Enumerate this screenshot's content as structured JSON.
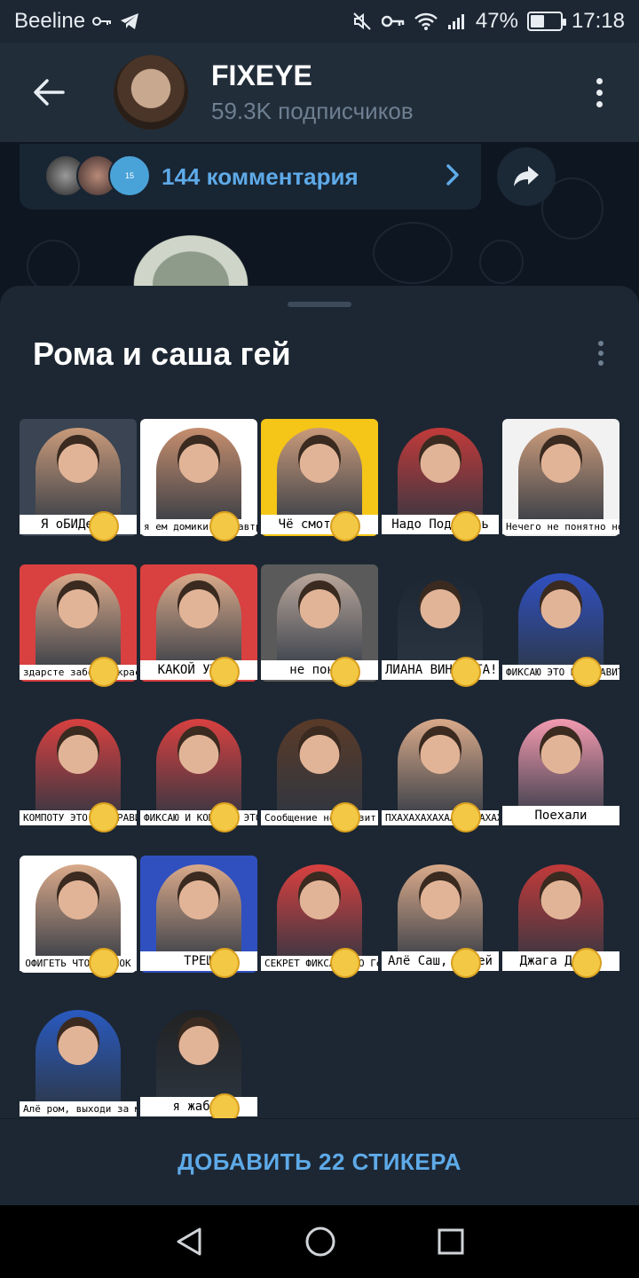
{
  "status_bar": {
    "carrier": "Beeline",
    "battery": "47%",
    "battery_level": 0.47,
    "time": "17:18"
  },
  "header": {
    "channel_name": "FIXEYE",
    "subscribers": "59.3K подписчиков"
  },
  "post": {
    "comments_label": "144 комментария",
    "comment_avatar_badge": "15"
  },
  "sheet": {
    "title": "Рома и саша гей",
    "add_button_label": "ДОБАВИТЬ 22 СТИКЕРА",
    "stickers": [
      {
        "caption": "Я оБИДеЛСЯ",
        "bg": "#3a4452",
        "tone": "#c99a7a",
        "emoji": true
      },
      {
        "caption": "я ем домики на завтрак",
        "bg": "#ffffff",
        "tone": "#c68e6e",
        "emoji": true
      },
      {
        "caption": "Чё смотришь",
        "bg": "#f5c518",
        "tone": "#c99a7a",
        "emoji": true
      },
      {
        "caption": "Надо Подумать",
        "bg": "#1d2733",
        "tone": "#c23a3a",
        "emoji": true
      },
      {
        "caption": "Нечего не понятно но очень интересно",
        "bg": "#f2f2f2",
        "tone": "#c99a7a",
        "emoji": false
      },
      {
        "caption": "здарсте забор покрасте",
        "bg": "#d94040",
        "tone": "#d9a98a",
        "emoji": true
      },
      {
        "caption": "КАКОЙ УЖАС!",
        "bg": "#d94040",
        "tone": "#d9a98a",
        "emoji": true
      },
      {
        "caption": "не понял",
        "bg": "#5a5a5a",
        "tone": "#b8a59a",
        "emoji": true
      },
      {
        "caption": "ЛИАНА ВИНОВАТА!",
        "bg": "#1d2733",
        "tone": "#1d2733",
        "emoji": true
      },
      {
        "caption": "ФИКСАЮ ЭТО НЕ НРАВИТСЯ",
        "bg": "#1d2733",
        "tone": "#3050c0",
        "emoji": true
      },
      {
        "caption": "КОМПОТУ ЭТО НЕ НРАВИТСЯ",
        "bg": "#1d2733",
        "tone": "#d94040",
        "emoji": true
      },
      {
        "caption": "ФИКСАЮ И КОМПОТУ ЭТО НЕ НРАВИТСЯ",
        "bg": "#1d2733",
        "tone": "#d94040",
        "emoji": true
      },
      {
        "caption": "Сообщение не грузит",
        "bg": "#1d2733",
        "tone": "#5a3a28",
        "emoji": true
      },
      {
        "caption": "ПХАХАХАХАХААХХАХАХАХА ХАХАХАХАААХАХАХАХАХ",
        "bg": "#1d2733",
        "tone": "#d9a98a",
        "emoji": true
      },
      {
        "caption": "Поехали",
        "bg": "#1d2733",
        "tone": "#f39ab0",
        "emoji": false
      },
      {
        "caption": "ОФИГЕТЬ ЧТОООО ШОК",
        "bg": "#ffffff",
        "tone": "#d9a98a",
        "emoji": true
      },
      {
        "caption": "ТРЕШ",
        "bg": "#3050c0",
        "tone": "#d9a98a",
        "emoji": true
      },
      {
        "caption": "СЕКРЕТ ФИКСАЯ ЭТО Гей",
        "bg": "#1d2733",
        "tone": "#d94040",
        "emoji": true
      },
      {
        "caption": "Алё Саш, я гей",
        "bg": "#1d2733",
        "tone": "#d9a98a",
        "emoji": true
      },
      {
        "caption": "Джага Джага",
        "bg": "#1d2733",
        "tone": "#c23a3a",
        "emoji": true
      },
      {
        "caption": "Алё ром, выходи за меня",
        "bg": "#1d2733",
        "tone": "#2a5ac0",
        "emoji": false
      },
      {
        "caption": "я жабка",
        "bg": "#1d2733",
        "tone": "#222222",
        "emoji": true
      }
    ]
  }
}
